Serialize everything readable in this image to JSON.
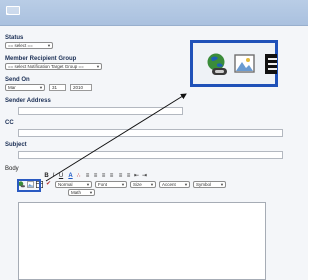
{
  "status": {
    "label": "Status",
    "select_value": "== select == "
  },
  "member_recipient_group": {
    "label": "Member Recipient Group",
    "select_value": "== select Notification Target Group == "
  },
  "send_on": {
    "label": "Send On",
    "month": "Mar",
    "day": "31",
    "year": "2010"
  },
  "sender_address": {
    "label": "Sender Address",
    "value": ""
  },
  "cc": {
    "label": "CC",
    "value": ""
  },
  "subject": {
    "label": "Subject",
    "value": ""
  },
  "body": {
    "label": "Body",
    "toolbar": {
      "bold": "B",
      "italic": "I",
      "underline": "U",
      "format_select": "Normal",
      "font_select": "Font",
      "size_select": "Size",
      "accent_select": "Accent",
      "symbol_select": "Symbol",
      "math_select": "Math"
    }
  },
  "icons": {
    "topbar": "envelope-icon",
    "insert_link": "globe-link-icon",
    "insert_image": "image-icon",
    "insert_table": "table-icon",
    "spellcheck": "spellcheck-icon"
  },
  "colors": {
    "highlight": "#1f51b8",
    "label": "#1b2f55",
    "topbar": "#b3c8e3"
  }
}
